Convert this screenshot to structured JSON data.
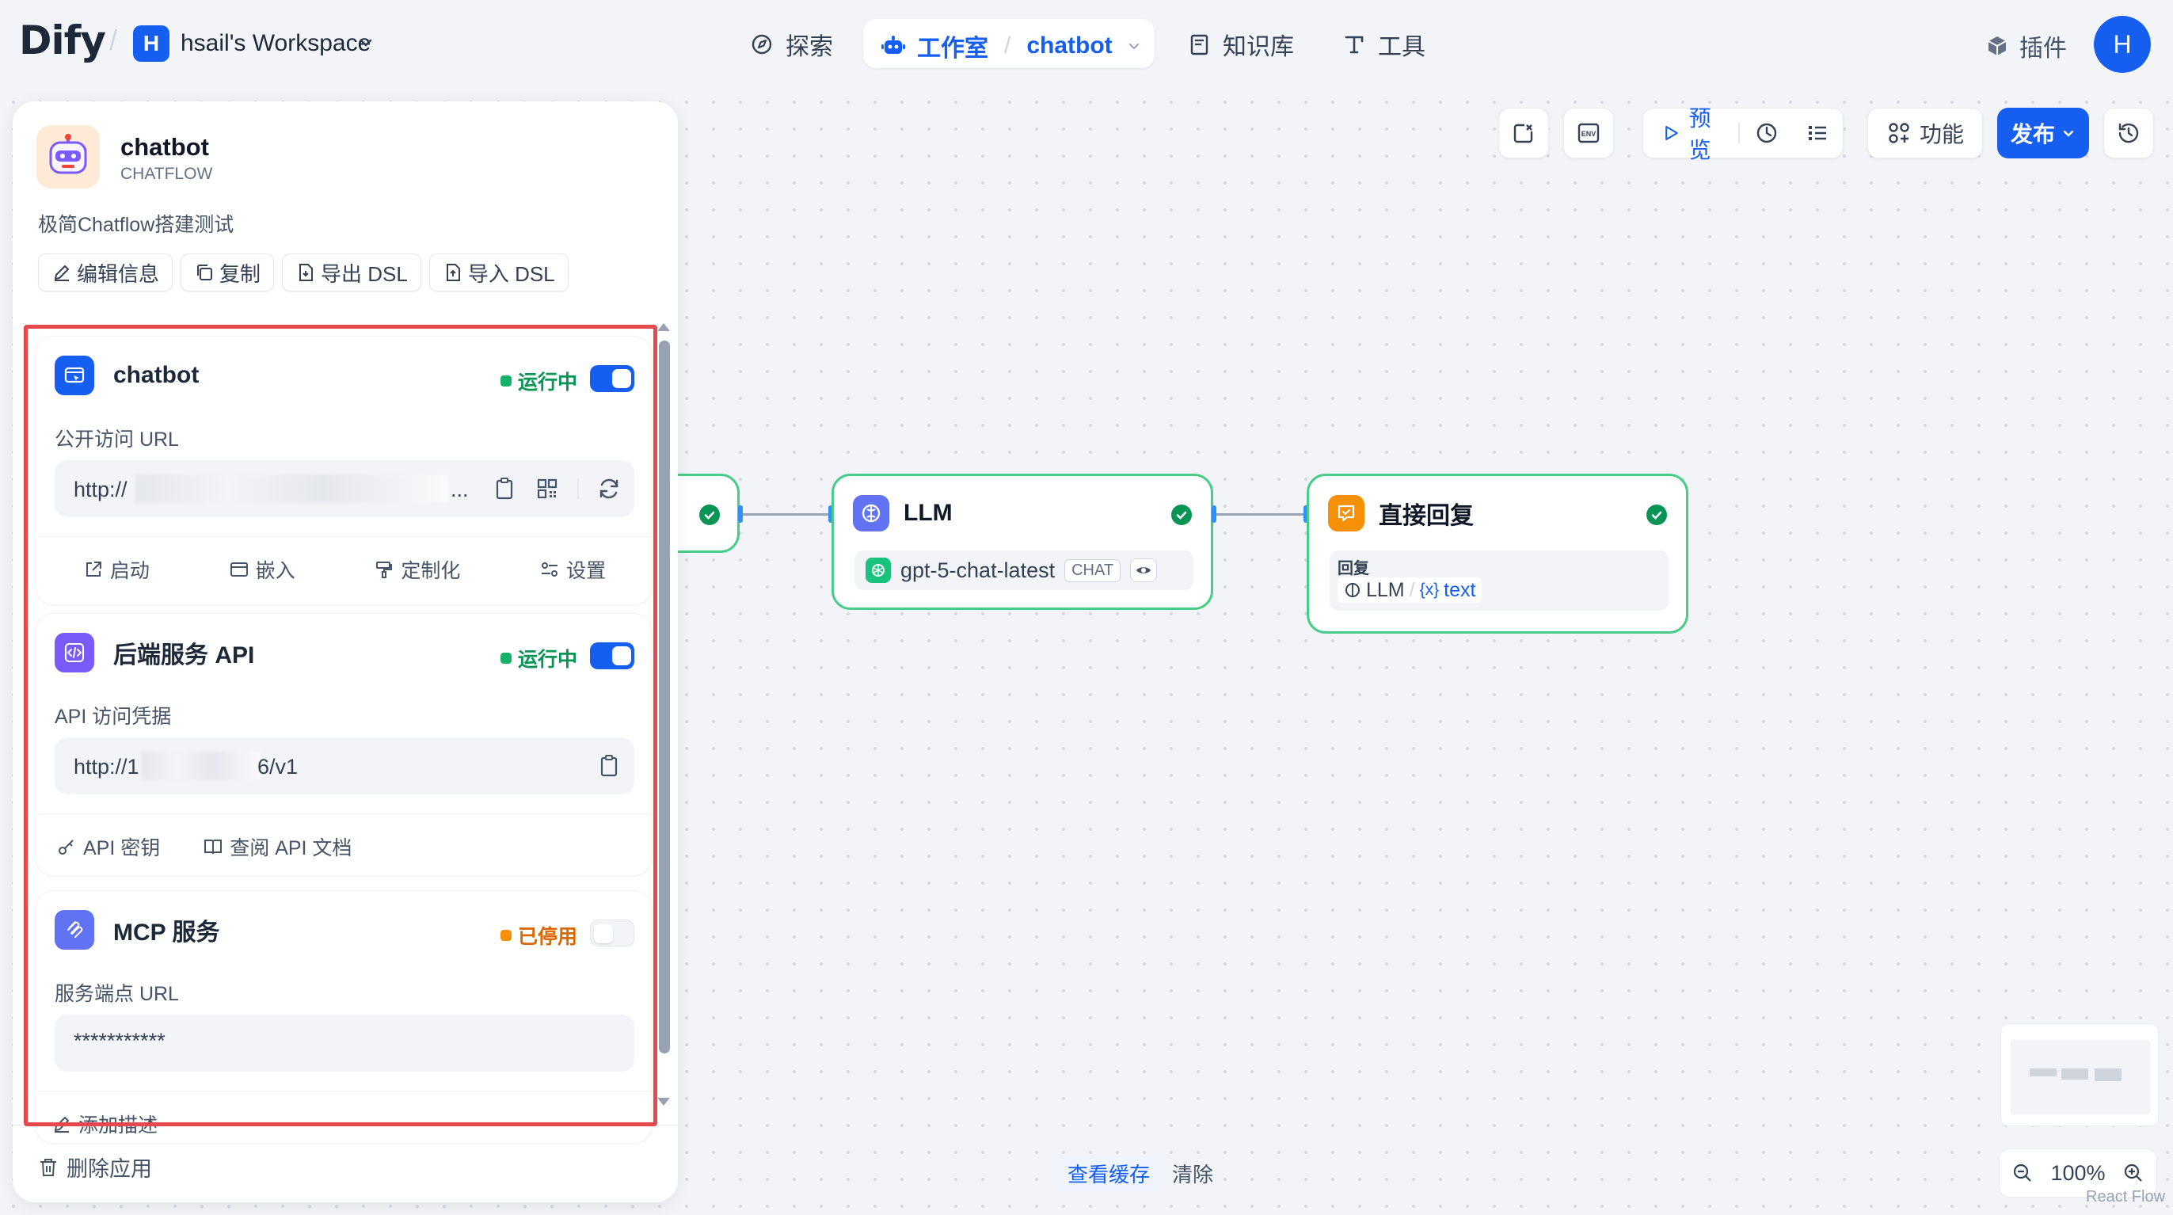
{
  "brand": {
    "logo": "Dify"
  },
  "workspace": {
    "avatar": "H",
    "name": "hsail's Workspace"
  },
  "nav": {
    "explore": "探索",
    "studio": "工作室",
    "current_app": "chatbot",
    "knowledge": "知识库",
    "tools": "工具",
    "plugins": "插件",
    "user_initial": "H"
  },
  "toolbar": {
    "env": "ENV",
    "preview": "预览",
    "features": "功能",
    "publish": "发布"
  },
  "app": {
    "name": "chatbot",
    "mode": "CHATFLOW",
    "description": "极简Chatflow搭建测试",
    "actions": [
      "编辑信息",
      "复制",
      "导出 DSL",
      "导入 DSL"
    ]
  },
  "webapp_card": {
    "title": "chatbot",
    "status": "运行中",
    "enabled": true,
    "url_label": "公开访问 URL",
    "url_start": "http://",
    "url_end": "...",
    "actions": [
      "启动",
      "嵌入",
      "定制化",
      "设置"
    ]
  },
  "api_card": {
    "title": "后端服务 API",
    "status": "运行中",
    "enabled": true,
    "url_label": "API 访问凭据",
    "url_start": "http://1",
    "url_end": "6/v1",
    "actions": [
      "API 密钥",
      "查阅 API 文档"
    ]
  },
  "mcp_card": {
    "title": "MCP 服务",
    "status": "已停用",
    "enabled": false,
    "url_label": "服务端点 URL",
    "url_value": "***********",
    "add_description": "添加描述"
  },
  "delete_app": "删除应用",
  "nodes": {
    "llm": {
      "title": "LLM",
      "model": "gpt-5-chat-latest",
      "badge": "CHAT"
    },
    "answer": {
      "title": "直接回复",
      "field_label": "回复",
      "var_node": "LLM",
      "var_name": "text",
      "var_prefix": "{x}"
    }
  },
  "bottom": {
    "view_cache": "查看缓存",
    "clear": "清除"
  },
  "zoom": {
    "level": "100%"
  },
  "watermark": "React Flow",
  "colors": {
    "primary": "#155eef",
    "success": "#17b26a",
    "warning": "#f79009",
    "node_border": "#47cd89",
    "highlight": "#e5484d"
  }
}
